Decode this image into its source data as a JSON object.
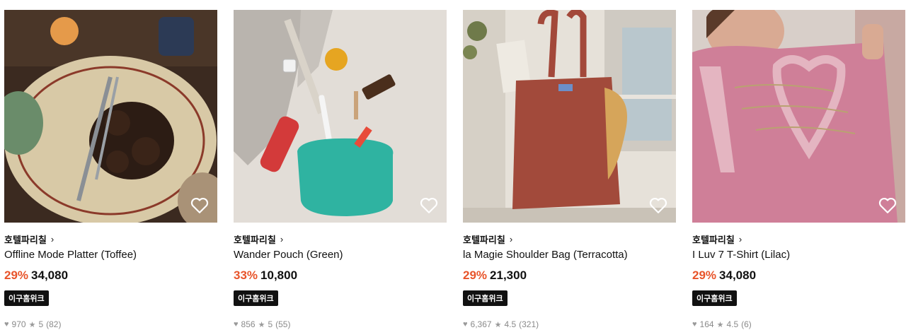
{
  "products": [
    {
      "brand": "호텔파리칠",
      "name": "Offline Mode Platter (Toffee)",
      "discount": "29%",
      "price": "34,080",
      "badge": "이구홈위크",
      "likes": "970",
      "rating": "5",
      "reviews": "(82)",
      "image_icon": "platter-photo"
    },
    {
      "brand": "호텔파리칠",
      "name": "Wander Pouch (Green)",
      "discount": "33%",
      "price": "10,800",
      "badge": "이구홈위크",
      "likes": "856",
      "rating": "5",
      "reviews": "(55)",
      "image_icon": "pouch-photo"
    },
    {
      "brand": "호텔파리칠",
      "name": "la Magie Shoulder Bag (Terracotta)",
      "discount": "29%",
      "price": "21,300",
      "badge": "이구홈위크",
      "likes": "6,367",
      "rating": "4.5",
      "reviews": "(321)",
      "image_icon": "bag-photo"
    },
    {
      "brand": "호텔파리칠",
      "name": "I Luv 7 T-Shirt (Lilac)",
      "discount": "29%",
      "price": "34,080",
      "badge": "이구홈위크",
      "likes": "164",
      "rating": "4.5",
      "reviews": "(6)",
      "image_icon": "tshirt-photo"
    }
  ],
  "colors": {
    "discount": "#e8542a",
    "badge_bg": "#111111",
    "meta_text": "#8a8a8a"
  }
}
